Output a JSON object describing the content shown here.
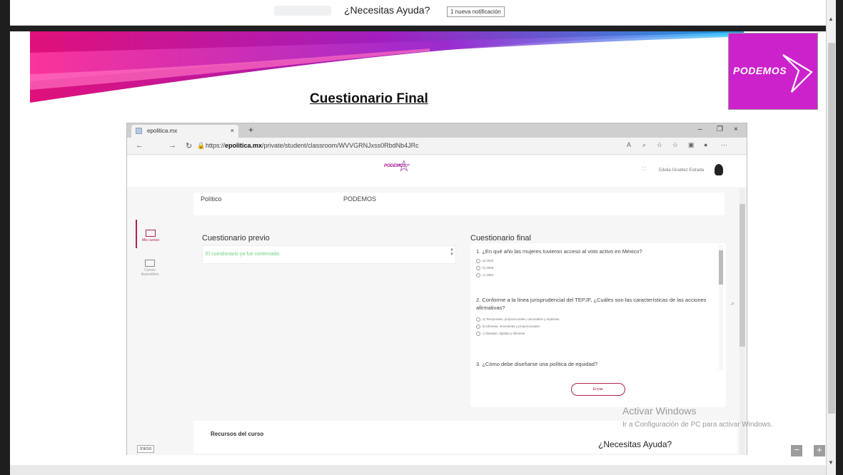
{
  "header": {
    "help_title": "¿Necesitas Ayuda?",
    "notification": "1 nueva notificación"
  },
  "slide": {
    "title": "Cuestionario Final",
    "logo_text": "PODEMOS",
    "brand_color": "#cc22cc"
  },
  "browser": {
    "tab_title": "epolitica.mx",
    "tab_close": "×",
    "new_tab": "+",
    "url_prefix": "https://",
    "url_domain": "epolitica.mx",
    "url_path": "/private/student/classroom/WVVGRNJxss0RbdNb4JRc",
    "win_min": "–",
    "win_max": "❐",
    "win_close": "×"
  },
  "app": {
    "logo_text": "PODEMOS",
    "user_name": "Edelia Giraldez Estrada",
    "sidebar": [
      {
        "label": "Mis cursos"
      },
      {
        "label": "Cursos disponibles"
      }
    ],
    "inicio": "Inicio",
    "info_row": {
      "left": "Político",
      "right": "PODEMOS"
    },
    "prev_title": "Cuestionario previo",
    "prev_message": "El cuestionario ya fue contestado.",
    "final_title": "Cuestionario final",
    "questions": [
      {
        "text": "1. ¿En qué año las mujeres tuvieron acceso al voto activo en México?",
        "options": [
          "a) 1920",
          "b) 2005",
          "c) 1953"
        ]
      },
      {
        "text": "2. Conforme a la línea jurisprudencial del TEPJF, ¿Cuáles son las características de las acciones afirmativas?",
        "options": [
          "a) Temporales, proporcionales, razonables y objetivas",
          "b) Idóneas, necesarias y proporcionales",
          "c) Baratas, rápidas y eficiente"
        ]
      },
      {
        "text": "3. ¿Cómo debe diseñarse una política de equidad?",
        "options": []
      }
    ],
    "send_button": "Enviar",
    "resources_title": "Recursos del curso",
    "help_bottom": "¿Necesitas Ayuda?"
  },
  "overlay": {
    "activar_title": "Activar Windows",
    "activar_sub": "Ir a Configuración de PC para activar Windows."
  },
  "controls": {
    "minus": "−",
    "plus": "+"
  }
}
